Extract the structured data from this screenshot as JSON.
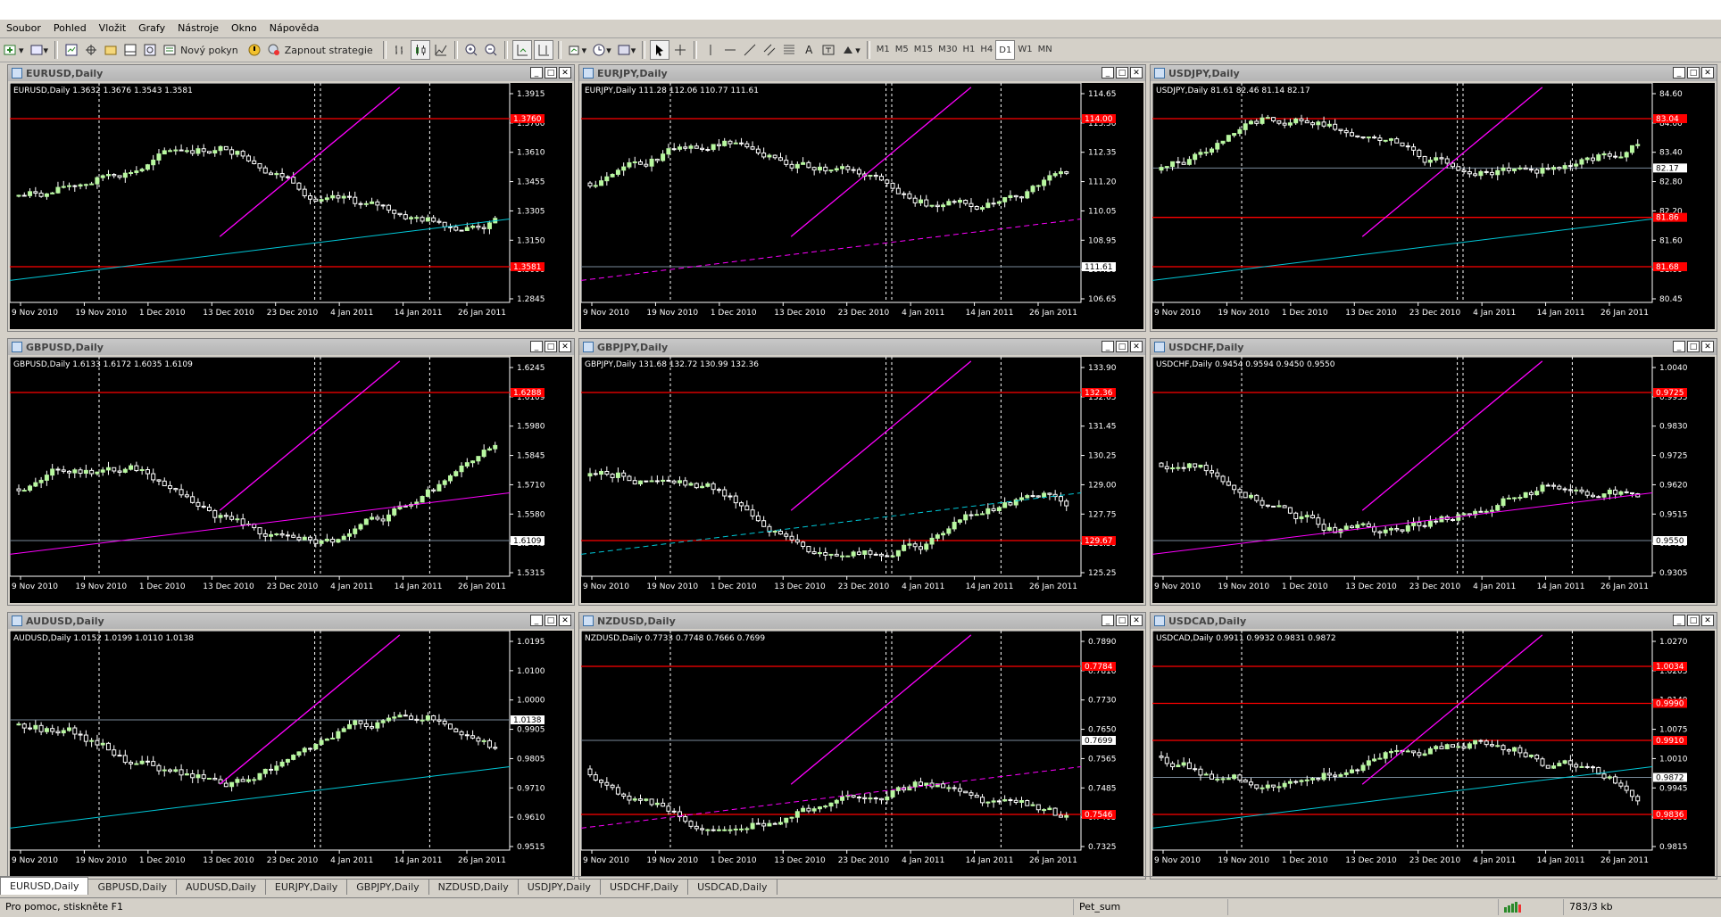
{
  "menu": [
    "Soubor",
    "Pohled",
    "Vložit",
    "Grafy",
    "Nástroje",
    "Okno",
    "Nápověda"
  ],
  "toolbar": {
    "new_order": "Nový pokyn",
    "autotrading": "Zapnout strategie",
    "timeframes": [
      "M1",
      "M5",
      "M15",
      "M30",
      "H1",
      "H4",
      "D1",
      "W1",
      "MN"
    ],
    "active_timeframe": "D1"
  },
  "colors": {
    "bull": "#b8f8a0",
    "bear": "#ffffff",
    "level": "#ff0000",
    "trend": "#ff00ff",
    "channel": "#00c8d8",
    "grid": "#ffffff",
    "bid": "#7a8a9a"
  },
  "charts": [
    {
      "symbol": "EURUSD,Daily",
      "info": "EURUSD,Daily  1.3632 1.3676 1.3543 1.3581",
      "price_labels": [
        "1.3915",
        "1.3760",
        "1.3610",
        "1.3455",
        "1.3305",
        "1.3150",
        "1.3000",
        "1.2845"
      ],
      "tags": [
        {
          "price": "1.3760",
          "color": "#ff0000"
        },
        {
          "price": "1.3581",
          "color": "#ff0000"
        }
      ],
      "dates": [
        "9 Nov 2010",
        "19 Nov 2010",
        "1 Dec 2010",
        "13 Dec 2010",
        "23 Dec 2010",
        "4 Jan 2011",
        "14 Jan 2011",
        "26 Jan 2011"
      ]
    },
    {
      "symbol": "EURJPY,Daily",
      "info": "EURJPY,Daily  111.28 112.06 110.77 111.61",
      "price_labels": [
        "114.65",
        "113.50",
        "112.35",
        "111.20",
        "110.05",
        "108.95",
        "107.80",
        "106.65"
      ],
      "tags": [
        {
          "price": "114.00",
          "color": "#ff0000"
        },
        {
          "price": "111.61",
          "color": "#ffffff"
        }
      ],
      "dates": [
        "9 Nov 2010",
        "19 Nov 2010",
        "1 Dec 2010",
        "13 Dec 2010",
        "23 Dec 2010",
        "4 Jan 2011",
        "14 Jan 2011",
        "26 Jan 2011"
      ]
    },
    {
      "symbol": "USDJPY,Daily",
      "info": "USDJPY,Daily  81.61 82.46 81.14 82.17",
      "price_labels": [
        "84.60",
        "84.00",
        "83.40",
        "82.80",
        "82.20",
        "81.60",
        "81.00",
        "80.45"
      ],
      "tags": [
        {
          "price": "83.04",
          "color": "#ff0000"
        },
        {
          "price": "82.17",
          "color": "#ffffff"
        },
        {
          "price": "81.86",
          "color": "#ff0000"
        },
        {
          "price": "81.68",
          "color": "#ff0000"
        }
      ],
      "dates": [
        "9 Nov 2010",
        "19 Nov 2010",
        "1 Dec 2010",
        "13 Dec 2010",
        "23 Dec 2010",
        "4 Jan 2011",
        "14 Jan 2011",
        "26 Jan 2011"
      ]
    },
    {
      "symbol": "GBPUSD,Daily",
      "info": "GBPUSD,Daily  1.6133 1.6172 1.6035 1.6109",
      "price_labels": [
        "1.6245",
        "1.6109",
        "1.5980",
        "1.5845",
        "1.5710",
        "1.5580",
        "1.5445",
        "1.5315"
      ],
      "tags": [
        {
          "price": "1.6288",
          "color": "#ff0000"
        },
        {
          "price": "1.6109",
          "color": "#ffffff"
        }
      ],
      "dates": [
        "9 Nov 2010",
        "19 Nov 2010",
        "1 Dec 2010",
        "13 Dec 2010",
        "23 Dec 2010",
        "4 Jan 2011",
        "14 Jan 2011",
        "26 Jan 2011"
      ]
    },
    {
      "symbol": "GBPJPY,Daily",
      "info": "GBPJPY,Daily  131.68 132.72 130.99 132.36",
      "price_labels": [
        "133.90",
        "132.65",
        "131.45",
        "130.25",
        "129.00",
        "127.75",
        "126.50",
        "125.25"
      ],
      "tags": [
        {
          "price": "132.36",
          "color": "#ff0000"
        },
        {
          "price": "129.67",
          "color": "#ff0000"
        }
      ],
      "dates": [
        "9 Nov 2010",
        "19 Nov 2010",
        "1 Dec 2010",
        "13 Dec 2010",
        "23 Dec 2010",
        "4 Jan 2011",
        "14 Jan 2011",
        "26 Jan 2011"
      ]
    },
    {
      "symbol": "USDCHF,Daily",
      "info": "USDCHF,Daily  0.9454 0.9594 0.9450 0.9550",
      "price_labels": [
        "1.0040",
        "0.9935",
        "0.9830",
        "0.9725",
        "0.9620",
        "0.9515",
        "0.9410",
        "0.9305"
      ],
      "tags": [
        {
          "price": "0.9725",
          "color": "#ff0000"
        },
        {
          "price": "0.9550",
          "color": "#ffffff"
        }
      ],
      "dates": [
        "9 Nov 2010",
        "19 Nov 2010",
        "1 Dec 2010",
        "13 Dec 2010",
        "23 Dec 2010",
        "4 Jan 2011",
        "14 Jan 2011",
        "26 Jan 2011"
      ]
    },
    {
      "symbol": "AUDUSD,Daily",
      "info": "AUDUSD,Daily  1.0152 1.0199 1.0110 1.0138",
      "price_labels": [
        "1.0195",
        "1.0100",
        "1.0000",
        "0.9905",
        "0.9805",
        "0.9710",
        "0.9610",
        "0.9515"
      ],
      "tags": [
        {
          "price": "1.0138",
          "color": "#ffffff"
        }
      ],
      "dates": [
        "9 Nov 2010",
        "19 Nov 2010",
        "1 Dec 2010",
        "13 Dec 2010",
        "23 Dec 2010",
        "4 Jan 2011",
        "14 Jan 2011",
        "26 Jan 2011"
      ]
    },
    {
      "symbol": "NZDUSD,Daily",
      "info": "NZDUSD,Daily  0.7733 0.7748 0.7666 0.7699",
      "price_labels": [
        "0.7890",
        "0.7810",
        "0.7730",
        "0.7650",
        "0.7565",
        "0.7485",
        "0.7405",
        "0.7325"
      ],
      "tags": [
        {
          "price": "0.7784",
          "color": "#ff0000"
        },
        {
          "price": "0.7699",
          "color": "#ffffff"
        },
        {
          "price": "0.7546",
          "color": "#ff0000"
        }
      ],
      "dates": [
        "9 Nov 2010",
        "19 Nov 2010",
        "1 Dec 2010",
        "13 Dec 2010",
        "23 Dec 2010",
        "4 Jan 2011",
        "14 Jan 2011",
        "26 Jan 2011"
      ]
    },
    {
      "symbol": "USDCAD,Daily",
      "info": "USDCAD,Daily  0.9911 0.9932 0.9831 0.9872",
      "price_labels": [
        "1.0270",
        "1.0205",
        "1.0140",
        "1.0075",
        "1.0010",
        "0.9945",
        "0.9880",
        "0.9815"
      ],
      "tags": [
        {
          "price": "1.0034",
          "color": "#ff0000"
        },
        {
          "price": "0.9990",
          "color": "#ff0000"
        },
        {
          "price": "0.9910",
          "color": "#ff0000"
        },
        {
          "price": "0.9872",
          "color": "#ffffff"
        },
        {
          "price": "0.9836",
          "color": "#ff0000"
        }
      ],
      "dates": [
        "9 Nov 2010",
        "19 Nov 2010",
        "1 Dec 2010",
        "13 Dec 2010",
        "23 Dec 2010",
        "4 Jan 2011",
        "14 Jan 2011",
        "26 Jan 2011"
      ]
    }
  ],
  "tabs": [
    "EURUSD,Daily",
    "GBPUSD,Daily",
    "AUDUSD,Daily",
    "EURJPY,Daily",
    "GBPJPY,Daily",
    "NZDUSD,Daily",
    "USDJPY,Daily",
    "USDCHF,Daily",
    "USDCAD,Daily"
  ],
  "active_tab": 0,
  "status": {
    "help": "Pro pomoc, stiskněte F1",
    "profile": "Pet_sum",
    "traffic": "783/3 kb"
  }
}
